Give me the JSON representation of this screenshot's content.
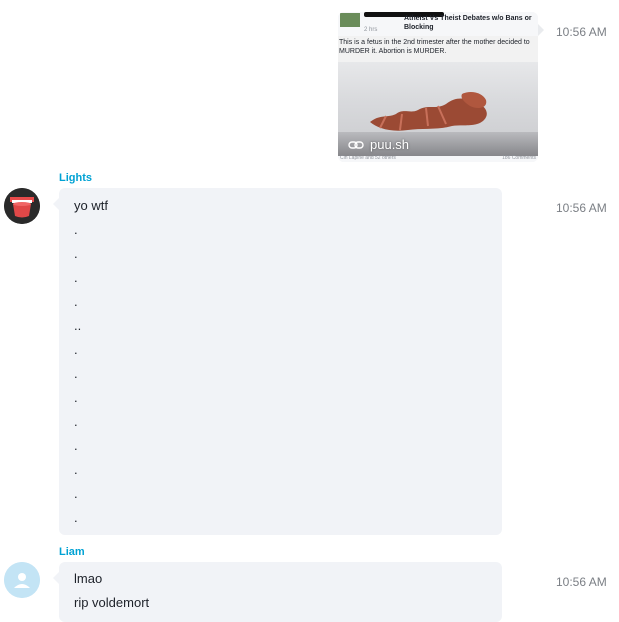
{
  "messages": {
    "image_message": {
      "time": "10:56 AM",
      "link_label": "puu.sh",
      "preview": {
        "group_title": "Atheist Vs Theist Debates w/o Bans or Blocking",
        "post_time": "2 hrs",
        "post_text": "This is a fetus in the 2nd trimester after the mother decided to MURDER it. Abortion is MURDER.",
        "reactions_text": "Cin Lapine and 52 others",
        "comments_text": "186 Comments"
      }
    },
    "lights": {
      "sender": "Lights",
      "time": "10:56 AM",
      "lines": [
        "yo wtf",
        ".",
        ".",
        ".",
        ".",
        "..",
        ".",
        ".",
        ".",
        ".",
        ".",
        ".",
        ".",
        "."
      ]
    },
    "liam": {
      "sender": "Liam",
      "time": "10:56 AM",
      "lines": [
        "lmao",
        "rip voldemort"
      ]
    }
  },
  "colors": {
    "sender": "#00a2d4",
    "bubble": "#f1f3f7",
    "timestamp": "#7b7f85"
  },
  "icons": [
    "link-icon",
    "user-avatar-icon"
  ]
}
